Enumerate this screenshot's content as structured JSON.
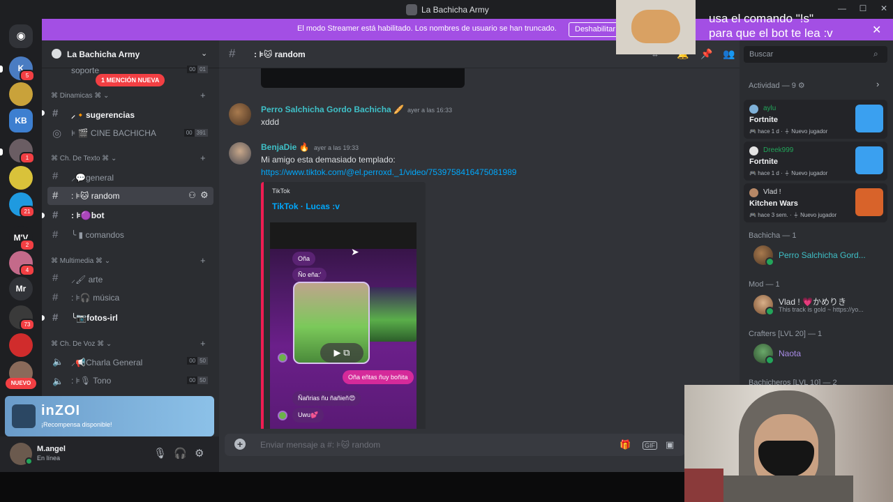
{
  "window": {
    "title": "La Bachicha Army"
  },
  "banner": {
    "text": "El modo Streamer está habilitado. Los nombres de usuario se han truncado.",
    "button": "Deshabilitar"
  },
  "overlay": {
    "line1": "usa el comando \"!s\"",
    "line2": "para que el bot te lea :v"
  },
  "rail": {
    "servers": [
      {
        "label": "K",
        "badge": "5",
        "color": "#4a7cc2"
      },
      {
        "label": "",
        "badge": "",
        "color": "#c9a23a"
      },
      {
        "label": "KB",
        "badge": "",
        "color": "#3d7fd0"
      },
      {
        "label": "",
        "badge": "1",
        "color": "#6a5d63"
      },
      {
        "label": "",
        "badge": "",
        "color": "#d9c23a"
      },
      {
        "label": "",
        "badge": "21",
        "color": "#1f9ae0"
      },
      {
        "label": "M'V",
        "badge": "2",
        "color": "#1e1f22"
      },
      {
        "label": "",
        "badge": "4",
        "color": "#c46a8a"
      },
      {
        "label": "Mr",
        "badge": "",
        "color": "#313338"
      },
      {
        "label": "",
        "badge": "73",
        "color": "#3a3a3a"
      },
      {
        "label": "",
        "badge": "",
        "color": "#d02c2c"
      },
      {
        "label": "",
        "badge": "",
        "color": "#8a6a5a"
      }
    ],
    "new_label": "NUEVO"
  },
  "server": {
    "name": "La Bachicha Army",
    "mention_pill": "1 MENCIÓN NUEVA",
    "top_channel": {
      "name": "soporte",
      "vc": [
        "00",
        "01"
      ]
    },
    "categories": [
      {
        "name": "Dinamicas",
        "glyph": "⌘"
      },
      {
        "name": "Ch. De Texto",
        "glyph": "⌘"
      },
      {
        "name": "Multimedia",
        "glyph": "⌘"
      },
      {
        "name": "Ch. De Voz",
        "glyph": "⌘"
      }
    ],
    "channels": {
      "sugerencias": "sugerencias",
      "cine": "CINE BACHICHA",
      "cine_vc": [
        "00",
        "391"
      ],
      "general": "general",
      "random": "random",
      "bot": "bot",
      "comandos": "comandos",
      "arte": "arte",
      "musica": "música",
      "fotos": "fotos-irl",
      "charla": "Charla General",
      "charla_vc": [
        "00",
        "50"
      ],
      "tono": "Tono",
      "tono_vc": [
        "00",
        "50"
      ]
    }
  },
  "promo": {
    "logo": "inZOI",
    "sub": "¡Recompensa disponible!"
  },
  "user": {
    "name": "M.angel",
    "status": "En línea"
  },
  "chat": {
    "channel": "random",
    "messages": [
      {
        "user": "Perro Salchicha Gordo Bachicha",
        "user_color": "#3fc0c7",
        "time": "ayer a las 16:33",
        "text": "xddd"
      },
      {
        "user": "BenjaDie",
        "user_color": "#3fc0c7",
        "time": "ayer a las 19:33",
        "text": "Mi amigo esta demasiado templado:",
        "link": "https://www.tiktok.com/@el.perroxd._1/video/7539758416475081989"
      }
    ],
    "embed": {
      "provider": "TikTok",
      "title": "TikTok · Lucas :v",
      "bubbles": [
        "Oña",
        "Ño eña:'",
        "Oña eñtas ñuy boñita",
        "Ñañrias ñu ñañieñ😍",
        "Uwu💕"
      ]
    },
    "composer_placeholder": "Enviar mensaje a #: ⊧🐱 random"
  },
  "members": {
    "search_placeholder": "Buscar",
    "activity_header": "Actividad — 9",
    "activities": [
      {
        "user": "aylu",
        "user_color": "#23a55a",
        "game": "Fortnite",
        "time": "hace 1 d",
        "tag": "Nuevo jugador",
        "img_color": "#3aa0f0"
      },
      {
        "user": "Dreek999",
        "user_color": "#23a55a",
        "game": "Fortnite",
        "time": "hace 1 d",
        "tag": "Nuevo jugador",
        "img_color": "#3aa0f0"
      },
      {
        "user": "Vlad !",
        "user_color": "#dbdee1",
        "game": "Kitchen Wars",
        "time": "hace 3 sem.",
        "tag": "Nuevo jugador",
        "img_color": "#d8632a"
      }
    ],
    "groups": [
      {
        "title": "Bachicha — 1",
        "name": "Perro Salchicha Gord...",
        "name_color": "#3fc0c7",
        "sub": ""
      },
      {
        "title": "Mod — 1",
        "name": "Vlad ! 💗かめりき",
        "name_color": "#dbdee1",
        "sub": "This track is gold ~ https://yo..."
      },
      {
        "title": "Crafters [LVL 20] — 1",
        "name": "Naota",
        "name_color": "#a88be6",
        "sub": ""
      },
      {
        "title": "Bachicheros [LVL 10] — 2",
        "name": "",
        "name_color": "#dbdee1",
        "sub": ""
      }
    ]
  }
}
